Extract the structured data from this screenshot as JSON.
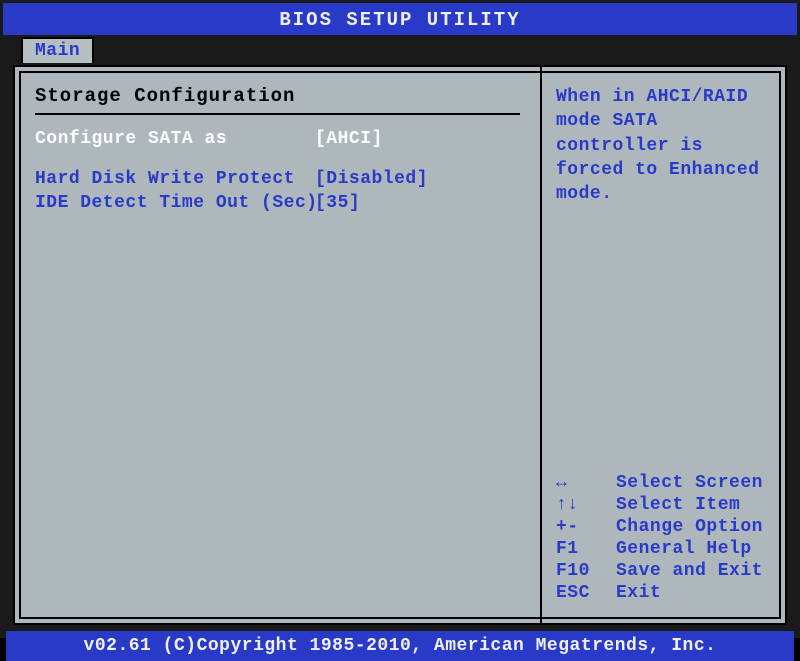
{
  "title": "BIOS SETUP UTILITY",
  "tab": "Main",
  "section_title": "Storage Configuration",
  "options": {
    "sata": {
      "label": "Configure SATA as",
      "value": "[AHCI]",
      "selected": true
    },
    "hdwp": {
      "label": "Hard Disk Write Protect",
      "value": "[Disabled]",
      "selected": false
    },
    "ide": {
      "label": "IDE Detect Time Out (Sec)",
      "value": "[35]",
      "selected": false
    }
  },
  "help_text": "When in AHCI/RAID mode SATA controller is forced to Enhanced mode.",
  "keyhints": [
    {
      "key": "↔",
      "action": "Select Screen"
    },
    {
      "key": "↑↓",
      "action": "Select Item"
    },
    {
      "key": "+-",
      "action": "Change Option"
    },
    {
      "key": "F1",
      "action": "General Help"
    },
    {
      "key": "F10",
      "action": "Save and Exit"
    },
    {
      "key": "ESC",
      "action": "Exit"
    }
  ],
  "footer": "v02.61 (C)Copyright 1985-2010, American Megatrends, Inc."
}
